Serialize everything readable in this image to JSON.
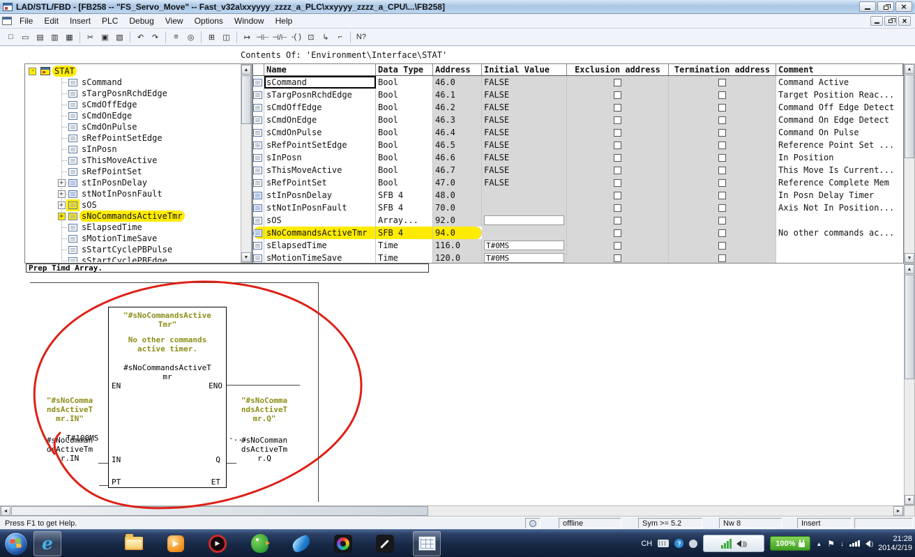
{
  "title_bar": {
    "title": "LAD/STL/FBD - [FB258 -- \"FS_Servo_Move\" -- Fast_v32a\\xxyyyy_zzzz_a_PLC\\xxyyyy_zzzz_a_CPU\\...\\FB258]"
  },
  "menu_bar": {
    "items": [
      "File",
      "Edit",
      "Insert",
      "PLC",
      "Debug",
      "View",
      "Options",
      "Window",
      "Help"
    ]
  },
  "toolbar": {
    "buttons": [
      {
        "name": "new-icon",
        "glyph": "□"
      },
      {
        "name": "open-icon",
        "glyph": "▭"
      },
      {
        "name": "save-all-icon",
        "glyph": "▤"
      },
      {
        "name": "save-icon",
        "glyph": "▥"
      },
      {
        "name": "print-icon",
        "glyph": "▦"
      },
      {
        "sep": true
      },
      {
        "name": "cut-icon",
        "glyph": "✂"
      },
      {
        "name": "copy-icon",
        "glyph": "▣"
      },
      {
        "name": "paste-icon",
        "glyph": "▧"
      },
      {
        "sep": true
      },
      {
        "name": "undo-icon",
        "glyph": "↶"
      },
      {
        "name": "redo-icon",
        "glyph": "↷"
      },
      {
        "sep": true
      },
      {
        "name": "symbol-info-icon",
        "glyph": "≡"
      },
      {
        "name": "monitor-icon",
        "glyph": "◎"
      },
      {
        "sep": true
      },
      {
        "name": "new-network-icon",
        "glyph": "⊞"
      },
      {
        "name": "window-split-icon",
        "glyph": "◫"
      },
      {
        "sep": true
      },
      {
        "name": "jump-label-icon",
        "glyph": "↦"
      },
      {
        "name": "contact-no-icon",
        "glyph": "⊣⊢"
      },
      {
        "name": "contact-nc-icon",
        "glyph": "⊣/⊢"
      },
      {
        "name": "coil-icon",
        "glyph": "-( )"
      },
      {
        "name": "empty-box-icon",
        "glyph": "⊡"
      },
      {
        "name": "open-branch-icon",
        "glyph": "↳"
      },
      {
        "name": "close-branch-icon",
        "glyph": "⌐"
      },
      {
        "sep": true
      },
      {
        "name": "help-cursor-icon",
        "glyph": "N?"
      }
    ]
  },
  "contents_header": "Contents Of: 'Environment\\Interface\\STAT'",
  "tree": {
    "root": {
      "label": "STAT",
      "highlighted": true
    },
    "items": [
      {
        "label": "sCommand"
      },
      {
        "label": "sTargPosnRchdEdge"
      },
      {
        "label": "sCmdOffEdge"
      },
      {
        "label": "sCmdOnEdge"
      },
      {
        "label": "sCmdOnPulse"
      },
      {
        "label": "sRefPointSetEdge"
      },
      {
        "label": "sInPosn"
      },
      {
        "label": "sThisMoveActive"
      },
      {
        "label": "sRefPointSet"
      },
      {
        "label": "stInPosnDelay",
        "expandable": true
      },
      {
        "label": "stNotInPosnFault",
        "expandable": true
      },
      {
        "label": "sOS",
        "expandable": true,
        "icon_highlight": true
      },
      {
        "label": "sNoCommandsActiveTmr",
        "expandable": true,
        "highlighted": true
      },
      {
        "label": "sElapsedTime"
      },
      {
        "label": "sMotionTimeSave"
      },
      {
        "label": "sStartCyclePBPulse"
      },
      {
        "label": "sStartCyclePBEdge"
      }
    ]
  },
  "table": {
    "columns": [
      "Name",
      "Data Type",
      "Address",
      "Initial Value",
      "Exclusion address",
      "Termination address",
      "Comment"
    ],
    "rows": [
      {
        "name": "sCommand",
        "data_type": "Bool",
        "address": "46.0",
        "initial_value": "FALSE",
        "comment": "Command Active",
        "focused": true
      },
      {
        "name": "sTargPosnRchdEdge",
        "data_type": "Bool",
        "address": "46.1",
        "initial_value": "FALSE",
        "comment": "Target Position Reac..."
      },
      {
        "name": "sCmdOffEdge",
        "data_type": "Bool",
        "address": "46.2",
        "initial_value": "FALSE",
        "comment": "Command Off Edge Detect"
      },
      {
        "name": "sCmdOnEdge",
        "data_type": "Bool",
        "address": "46.3",
        "initial_value": "FALSE",
        "comment": "Command On Edge Detect"
      },
      {
        "name": "sCmdOnPulse",
        "data_type": "Bool",
        "address": "46.4",
        "initial_value": "FALSE",
        "comment": "Command On Pulse"
      },
      {
        "name": "sRefPointSetEdge",
        "data_type": "Bool",
        "address": "46.5",
        "initial_value": "FALSE",
        "comment": "Reference Point Set ..."
      },
      {
        "name": "sInPosn",
        "data_type": "Bool",
        "address": "46.6",
        "initial_value": "FALSE",
        "comment": "In Position"
      },
      {
        "name": "sThisMoveActive",
        "data_type": "Bool",
        "address": "46.7",
        "initial_value": "FALSE",
        "comment": "This Move Is Current..."
      },
      {
        "name": "sRefPointSet",
        "data_type": "Bool",
        "address": "47.0",
        "initial_value": "FALSE",
        "comment": "Reference Complete Mem"
      },
      {
        "name": "stInPosnDelay",
        "data_type": "SFB 4",
        "address": "48.0",
        "initial_value": "",
        "comment": "In Posn Delay Timer",
        "composite": true
      },
      {
        "name": "stNotInPosnFault",
        "data_type": "SFB 4",
        "address": "70.0",
        "initial_value": "",
        "comment": "Axis Not In Position...",
        "composite": true
      },
      {
        "name": "sOS",
        "data_type": "Array...",
        "address": "92.0",
        "initial_value": "",
        "comment": "",
        "editable_blank": true
      },
      {
        "name": "sNoCommandsActiveTmr",
        "data_type": "SFB 4",
        "address": "94.0",
        "initial_value": "",
        "comment": "No other commands ac...",
        "composite": true,
        "highlighted": true
      },
      {
        "name": "sElapsedTime",
        "data_type": "Time",
        "address": "116.0",
        "initial_value": "T#0MS",
        "comment": "",
        "editable": true
      },
      {
        "name": "sMotionTimeSave",
        "data_type": "Time",
        "address": "120.0",
        "initial_value": "T#0MS",
        "comment": "",
        "editable": true
      }
    ]
  },
  "splitter_text": "Prep Timd Array.",
  "diagram": {
    "block": {
      "symbol_comment": [
        "\"#sNoCommandsActive",
        "Tmr\""
      ],
      "comment": [
        "No other commands",
        "active timer."
      ],
      "instance": [
        "#sNoCommandsActiveT",
        "mr"
      ],
      "pins": {
        "en": "EN",
        "eno": "ENO",
        "in": "IN",
        "q": "Q",
        "pt": "PT",
        "et": "ET"
      }
    },
    "in_operand": {
      "symbol": [
        "\"#sNoComma",
        "ndsActiveT",
        "mr.IN\""
      ],
      "address": [
        "#sNoComman",
        "dsActiveTm",
        "r.IN"
      ]
    },
    "q_operand": {
      "symbol": [
        "\"#sNoComma",
        "ndsActiveT",
        "mr.Q\""
      ],
      "address": [
        "#sNoComman",
        "dsActiveTm",
        "r.Q"
      ]
    },
    "pt_value": "T#100MS",
    "et_value": "-..."
  },
  "status_bar": {
    "help": "Press F1 to get Help.",
    "connection": "offline",
    "sym": "Sym >= 5.2",
    "network": "Nw 8",
    "mode": "Insert"
  },
  "taskbar": {
    "lang": "CH",
    "battery": "100%",
    "time": "21:28",
    "date": "2014/2/19",
    "apps": [
      {
        "name": "ie",
        "active": true
      },
      {
        "name": "explorer"
      },
      {
        "name": "media-player"
      },
      {
        "name": "media-player-red"
      },
      {
        "name": "parrot-app"
      },
      {
        "name": "swallow-app"
      },
      {
        "name": "color-ring-app"
      },
      {
        "name": "stylus-app"
      },
      {
        "name": "step7-editor",
        "active": true
      }
    ]
  }
}
